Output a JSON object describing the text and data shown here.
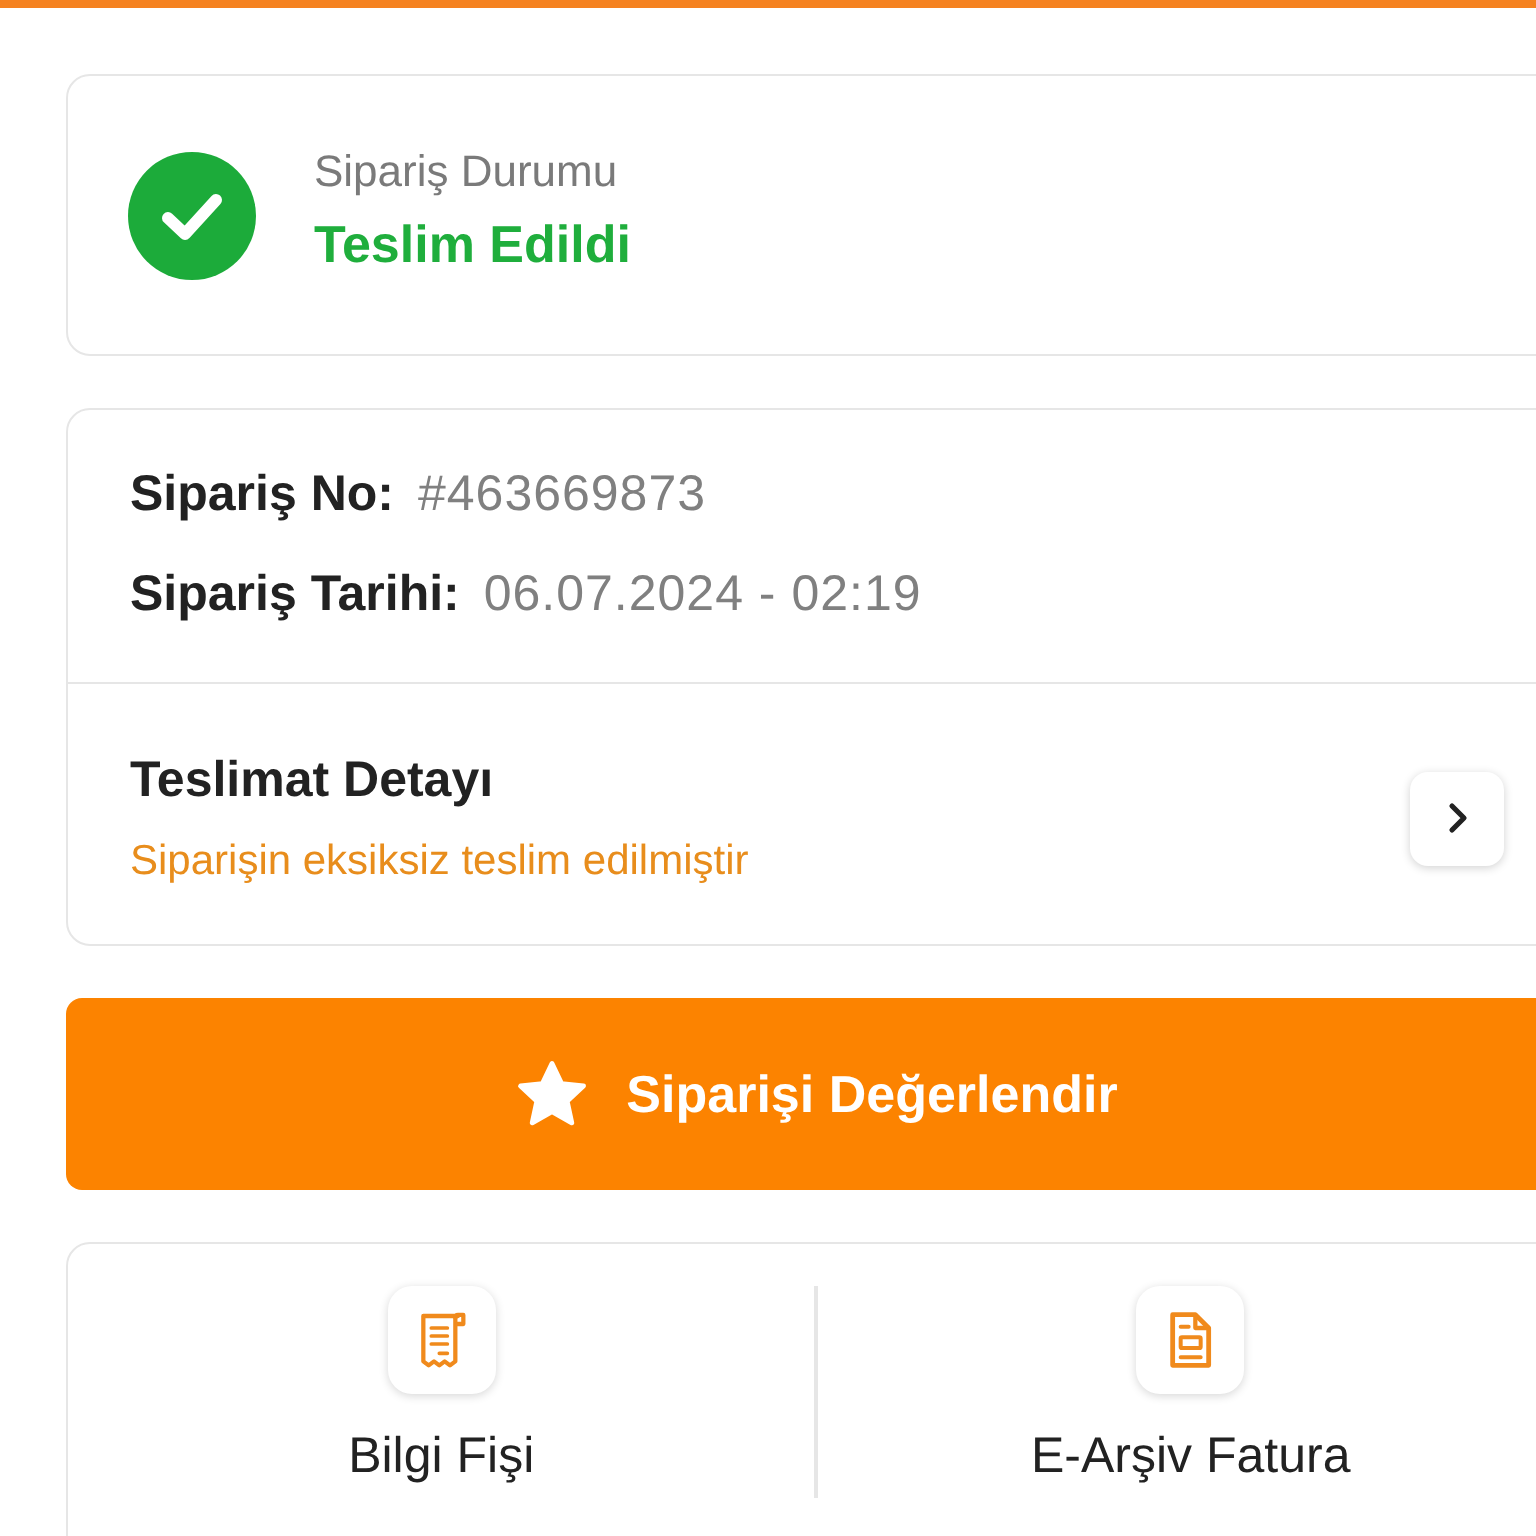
{
  "status_card": {
    "label": "Sipariş Durumu",
    "status": "Teslim Edildi"
  },
  "order_card": {
    "rows": [
      {
        "label": "Sipariş No:",
        "value": "#463669873"
      },
      {
        "label": "Sipariş Tarihi:",
        "value": "06.07.2024 - 02:19"
      }
    ],
    "delivery": {
      "title": "Teslimat Detayı",
      "note": "Siparişin eksiksiz teslim edilmiştir"
    }
  },
  "rate_button": {
    "label": "Siparişi Değerlendir"
  },
  "documents": [
    {
      "label": "Bilgi Fişi",
      "kind": "receipt"
    },
    {
      "label": "E-Arşiv Fatura",
      "kind": "invoice"
    }
  ]
}
